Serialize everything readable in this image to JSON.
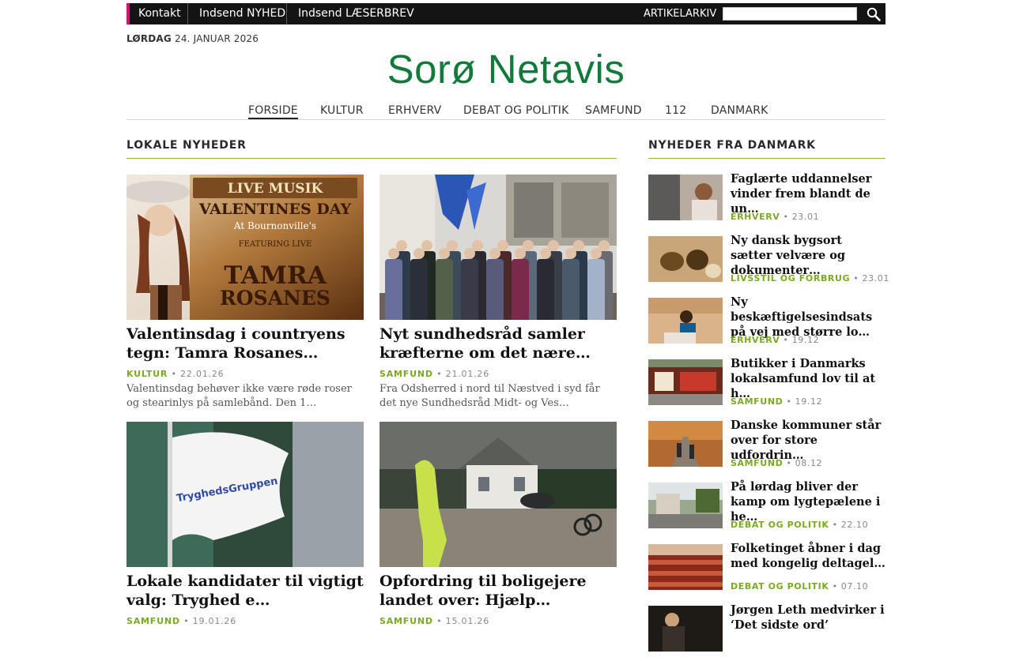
{
  "topbar": {
    "links": [
      "Kontakt",
      "Indsend NYHED",
      "Indsend LÆSERBREV"
    ],
    "archive_label": "ARTIKELARKIV",
    "search_value": ""
  },
  "date": {
    "weekday": "LØRDAG",
    "rest": "24. JANUAR 2026"
  },
  "site": {
    "name": "Sorø Netavis",
    "brand_color": "#147a3c"
  },
  "nav": [
    "FORSIDE",
    "KULTUR",
    "ERHVERV",
    "DEBAT OG POLITIK",
    "SAMFUND",
    "112",
    "DANMARK"
  ],
  "local": {
    "heading": "LOKALE NYHEDER",
    "articles": [
      {
        "image_text_1": "LIVE MUSIK",
        "image_text_2": "VALENTINES DAY",
        "image_text_3": "At Bournonville's",
        "image_text_4": "FEATURING LIVE",
        "image_text_5": "TAMRA",
        "image_text_6": "ROSANES",
        "title": "Valentinsdag i countryens tegn: Tamra Rosanes…",
        "category": "KULTUR",
        "date": "• 22.01.26",
        "excerpt": "Valentinsdag behøver ikke være røde roser og stearinlys på samlebånd. Den 1…"
      },
      {
        "title": "Nyt sundhedsråd samler kræfterne om det nære…",
        "category": "SAMFUND",
        "date": "• 21.01.26",
        "excerpt": "Fra Odsherred i nord til Næstved i syd får det nye Sundhedsråd Midt- og Ves…"
      },
      {
        "image_text_1": "TryghedsGruppen",
        "title": "Lokale kandidater til vigtigt valg: Tryghed e…",
        "category": "SAMFUND",
        "date": "• 19.01.26",
        "excerpt": ""
      },
      {
        "title": "Opfordring til boligejere landet over: Hjælp…",
        "category": "SAMFUND",
        "date": "• 15.01.26",
        "excerpt": ""
      }
    ]
  },
  "national": {
    "heading": "NYHEDER FRA DANMARK",
    "items": [
      {
        "title": "Faglærte uddannelser vinder frem blandt de un…",
        "category": "ERHVERV",
        "date": "• 23.01"
      },
      {
        "title": "Ny dansk bygsort sætter velvære og dokumenter…",
        "category": "LIVSSTIL OG FORBRUG",
        "date": "• 23.01"
      },
      {
        "title": "Ny beskæftigelsesindsats på vej med større lo…",
        "category": "ERHVERV",
        "date": "• 19.12"
      },
      {
        "title": "Butikker i Danmarks lokalsamfund lov til at h…",
        "category": "SAMFUND",
        "date": "• 19.12"
      },
      {
        "title": "Danske kommuner står over for store udfordrin…",
        "category": "SAMFUND",
        "date": "• 08.12"
      },
      {
        "title": "På lørdag bliver der kamp om lygtepælene i he…",
        "category": "DEBAT OG POLITIK",
        "date": "• 22.10"
      },
      {
        "title": "Folketinget åbner i dag med kongelig deltagel…",
        "category": "DEBAT OG POLITIK",
        "date": "• 07.10"
      },
      {
        "title": "Jørgen Leth medvirker i ‘Det sidste ord’",
        "category": "",
        "date": ""
      }
    ]
  },
  "colors": {
    "accent_green": "#7aaa22",
    "topbar": "#141414",
    "topbar_accent": "#d4146b"
  }
}
